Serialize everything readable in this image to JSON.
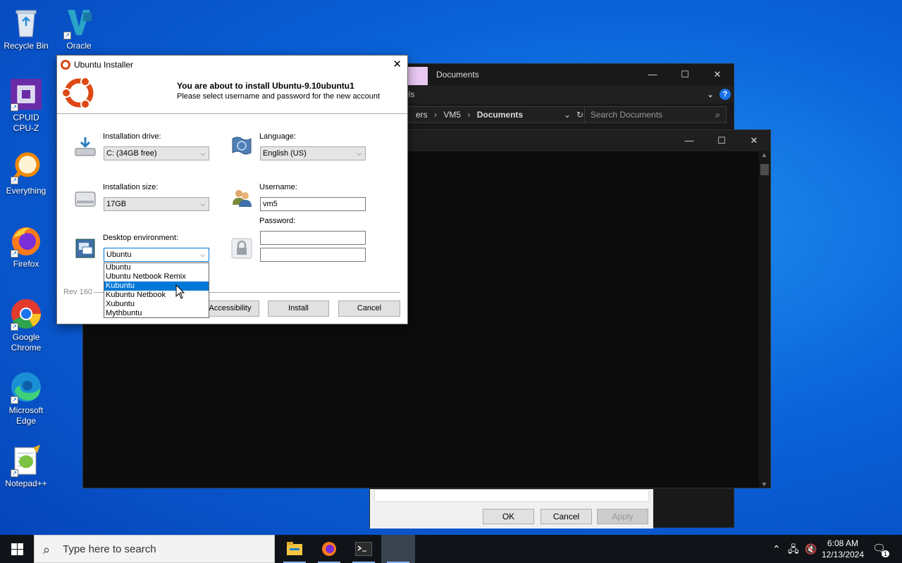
{
  "desktop": {
    "icons": [
      {
        "label": "Recycle Bin"
      },
      {
        "label": "Oracle"
      },
      {
        "label": "CPUID\nCPU-Z"
      },
      {
        "label": "Everything"
      },
      {
        "label": "Firefox"
      },
      {
        "label": "Google\nChrome"
      },
      {
        "label": "Microsoft\nEdge"
      },
      {
        "label": "Notepad++"
      }
    ]
  },
  "explorer": {
    "title": "Documents",
    "ribbon_tab": "ols",
    "breadcrumb": [
      "ers",
      "VM5",
      "Documents"
    ],
    "search_placeholder": "Search Documents",
    "buttons": {
      "ok": "OK",
      "cancel": "Cancel",
      "apply": "Apply"
    }
  },
  "installer": {
    "title": "Ubuntu Installer",
    "heading": "You are about to install Ubuntu-9.10ubuntu1",
    "subheading": "Please select username and password for the new account",
    "installation_drive": {
      "label": "Installation drive:",
      "value": "C: (34GB free)"
    },
    "installation_size": {
      "label": "Installation size:",
      "value": "17GB"
    },
    "desktop_environment": {
      "label": "Desktop environment:",
      "value": "Ubuntu",
      "options": [
        "Ubuntu",
        "Ubuntu Netbook Remix",
        "Kubuntu",
        "Kubuntu Netbook",
        "Xubuntu",
        "Mythbuntu"
      ],
      "highlighted": "Kubuntu"
    },
    "language": {
      "label": "Language:",
      "value": "English (US)"
    },
    "username": {
      "label": "Username:",
      "value": "vm5"
    },
    "password": {
      "label": "Password:",
      "value": "",
      "confirm": ""
    },
    "revision": "Rev 160",
    "buttons": {
      "accessibility": "Accessibility",
      "install": "Install",
      "cancel": "Cancel"
    }
  },
  "taskbar": {
    "search_placeholder": "Type here to search",
    "time": "6:08 AM",
    "date": "12/13/2024",
    "notification_count": "1"
  },
  "colors": {
    "accent": "#0078d7",
    "ubuntu_orange": "#dd4814"
  }
}
